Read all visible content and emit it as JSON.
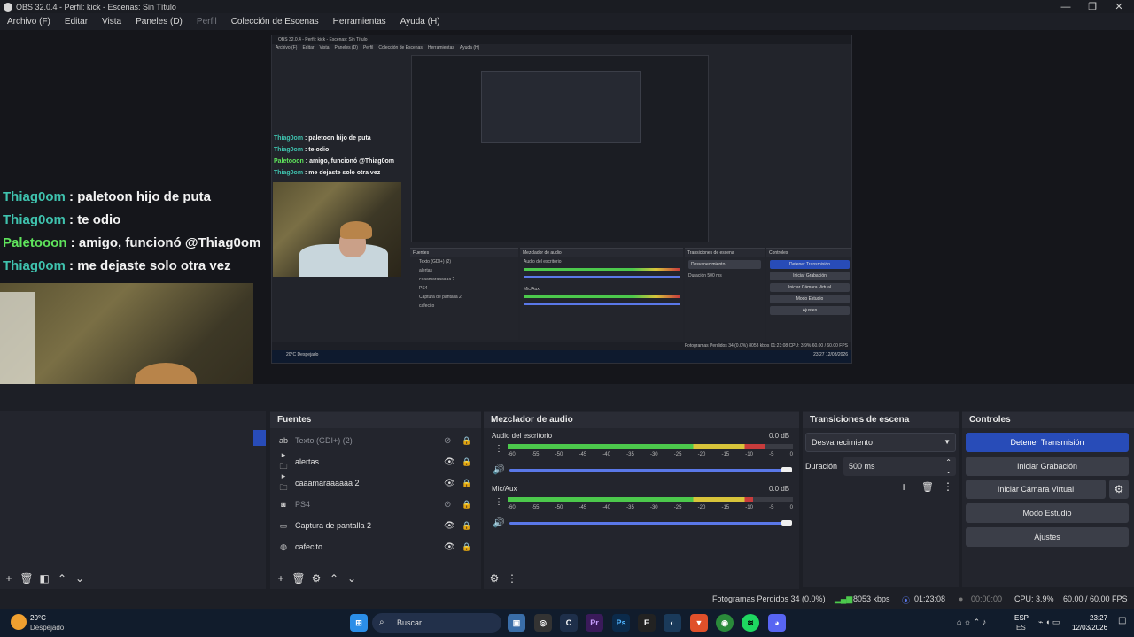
{
  "window": {
    "title": "OBS 32.0.4 - Perfil: kick - Escenas: Sin Título",
    "minimize": "—",
    "maximize": "❐",
    "close": "✕"
  },
  "menu": [
    "Archivo (F)",
    "Editar",
    "Vista",
    "Paneles (D)",
    "Perfil",
    "Colección de Escenas",
    "Herramientas",
    "Ayuda (H)"
  ],
  "chat": [
    {
      "name": "Thiag0om",
      "sep": " : ",
      "text": "paletoon hijo de puta"
    },
    {
      "name": "Thiag0om",
      "sep": " : ",
      "text": "te odio"
    },
    {
      "name": "Paletooon",
      "sep": " : ",
      "text": "amigo, funcionó @Thiag0om"
    },
    {
      "name": "Thiag0om",
      "sep": " : ",
      "text": "me dejaste solo otra vez"
    }
  ],
  "nested": {
    "title": "OBS 32.0.4 - Perfil: kick - Escenas: Sin Título",
    "menu": [
      "Archivo (F)",
      "Editar",
      "Vista",
      "Paneles (D)",
      "Perfil",
      "Colección de Escenas",
      "Herramientas",
      "Ayuda (H)"
    ],
    "panels": {
      "fuentes": "Fuentes",
      "mezclador": "Mezclador de audio",
      "transiciones": "Transiciones de escena",
      "controles": "Controles"
    },
    "sources": [
      "Texto (GDI+) (2)",
      "alertas",
      "caaamaraaaaaa 2",
      "PS4",
      "Captura de pantalla 2",
      "cafecito"
    ],
    "mix": [
      "Audio del escritorio",
      "Mic/Aux"
    ],
    "transition": "Desvanecimiento",
    "duration_label": "Duración",
    "duration": "500 ms",
    "buttons": [
      "Detener Transmisión",
      "Iniciar Grabación",
      "Iniciar Cámara Virtual",
      "Modo Estudio",
      "Ajustes"
    ],
    "status": "Fotogramas Perdidos 34 (0.0%)   8053 kbps   01:23:08   CPU: 3.9%   60.00 / 60.00 FPS",
    "weather": "20°C Despejado",
    "clock": "23:27 12/03/2026"
  },
  "docks": {
    "fuentes": {
      "title": "Fuentes",
      "items": [
        {
          "icon": "text-icon",
          "glyph": "ab",
          "label": "Texto (GDI+) (2)",
          "hidden": true
        },
        {
          "icon": "folder-icon",
          "glyph": "▸ 🗀",
          "label": "alertas",
          "hidden": false
        },
        {
          "icon": "folder-icon",
          "glyph": "▸ 🗀",
          "label": "caaamaraaaaaa 2",
          "hidden": false
        },
        {
          "icon": "camera-icon",
          "glyph": "◙",
          "label": "PS4",
          "hidden": true
        },
        {
          "icon": "monitor-icon",
          "glyph": "▭",
          "label": "Captura de pantalla 2",
          "hidden": false
        },
        {
          "icon": "globe-icon",
          "glyph": "◍",
          "label": "cafecito",
          "hidden": false
        }
      ]
    },
    "mezclador": {
      "title": "Mezclador de audio",
      "channels": [
        {
          "name": "Audio del escritorio",
          "db": "0.0 dB",
          "level": 0.9,
          "volume": 1.0
        },
        {
          "name": "Mic/Aux",
          "db": "0.0 dB",
          "level": 0.86,
          "volume": 1.0
        }
      ],
      "ticks": [
        "-60",
        "-55",
        "-50",
        "-45",
        "-40",
        "-35",
        "-30",
        "-25",
        "-20",
        "-15",
        "-10",
        "-5",
        "0"
      ]
    },
    "transiciones": {
      "title": "Transiciones de escena",
      "transition": "Desvanecimiento",
      "duration_label": "Duración",
      "duration": "500 ms"
    },
    "controles": {
      "title": "Controles",
      "stop_stream": "Detener Transmisión",
      "start_record": "Iniciar Grabación",
      "start_vcam": "Iniciar Cámara Virtual",
      "studio": "Modo Estudio",
      "settings": "Ajustes"
    }
  },
  "status": {
    "dropped": "Fotogramas Perdidos 34 (0.0%)",
    "bitrate": "8053 kbps",
    "stream_time": "01:23:08",
    "record_time": "00:00:00",
    "cpu": "CPU: 3.9%",
    "fps": "60.00 / 60.00 FPS"
  },
  "taskbar": {
    "temp": "20°C",
    "weather": "Despejado",
    "search": "Buscar",
    "lang1": "ESP",
    "lang2": "ES",
    "time": "23:27",
    "date": "12/03/2026"
  },
  "colors": {
    "accent": "#284cb8",
    "chat_name": "#3fc2ae",
    "chat_name_alt": "#5fe45c",
    "meter_green": "#4cc94c",
    "meter_yellow": "#d8c43a",
    "meter_red": "#c83c3c"
  }
}
